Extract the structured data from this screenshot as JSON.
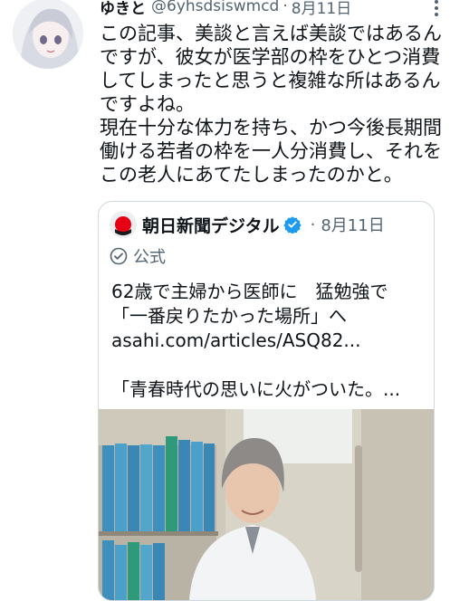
{
  "tweet": {
    "display_name": "ゆきと",
    "handle": "@6yhsdsisw​mcd",
    "separator": "·",
    "date": "8月11日",
    "text_lines": [
      "この記事、美談と言えば美談ではあるん",
      "ですが、彼女が医学部の枠をひとつ消費",
      "してしまったと思うと複雑な所はあるん",
      "ですよね。",
      "現在十分な体力を持ち、かつ今後長期間",
      "働ける若者の枠を一人分消費し、それを",
      "この老人にあてたしまったのかと。"
    ]
  },
  "quote": {
    "name": "朝日新聞デジタル",
    "separator": "·",
    "date": "8月11日",
    "badge": "公式",
    "lines": [
      "62歳で主婦から医師に　猛勉強で",
      "「一番戻りたかった場所」へ",
      "asahi.com/articles/ASQ82...",
      "",
      "「青春時代の思いに火がついた。..."
    ]
  },
  "colors": {
    "text": "#0f1419",
    "secondary": "#536471",
    "border": "#cfd9de",
    "verified": "#1d9bf0"
  },
  "icons": [
    "user-avatar-icon",
    "more-options-icon",
    "asahi-logo-icon",
    "verified-badge-icon",
    "official-check-icon"
  ]
}
